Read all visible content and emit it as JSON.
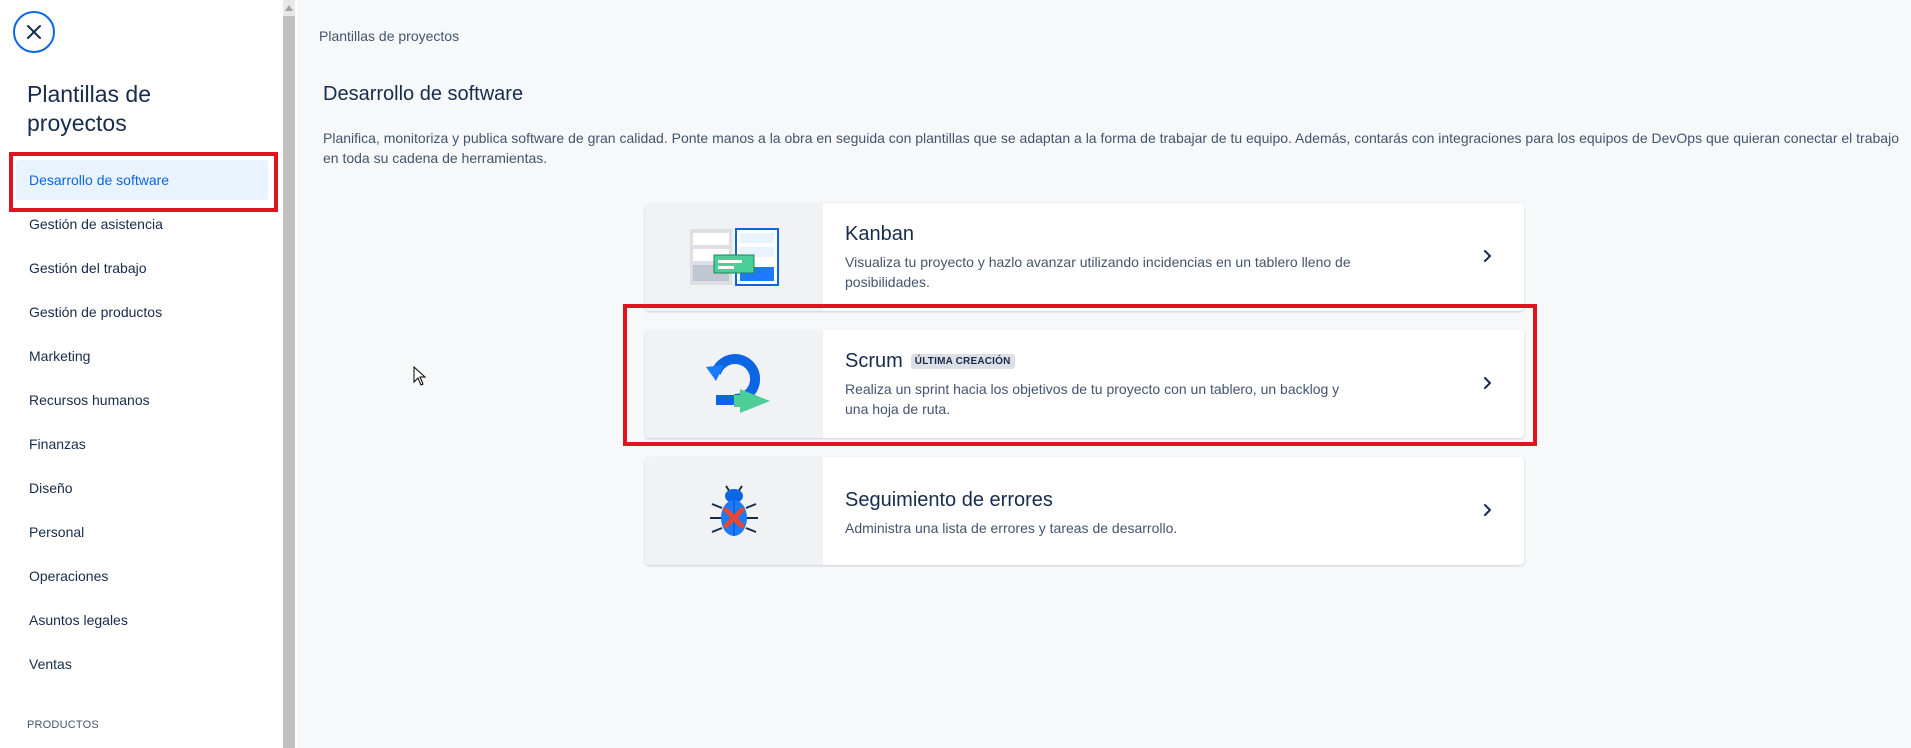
{
  "sidebar": {
    "title": "Plantillas de proyectos",
    "items": [
      {
        "label": "Desarrollo de software",
        "active": true
      },
      {
        "label": "Gestión de asistencia"
      },
      {
        "label": "Gestión del trabajo"
      },
      {
        "label": "Gestión de productos"
      },
      {
        "label": "Marketing"
      },
      {
        "label": "Recursos humanos"
      },
      {
        "label": "Finanzas"
      },
      {
        "label": "Diseño"
      },
      {
        "label": "Personal"
      },
      {
        "label": "Operaciones"
      },
      {
        "label": "Asuntos legales"
      },
      {
        "label": "Ventas"
      }
    ],
    "products_label": "PRODUCTOS"
  },
  "main": {
    "breadcrumb": "Plantillas de proyectos",
    "title": "Desarrollo de software",
    "description": "Planifica, monitoriza y publica software de gran calidad. Ponte manos a la obra en seguida con plantillas que se adaptan a la forma de trabajar de tu equipo. Además, contarás con integraciones para los equipos de DevOps que quieran conectar el trabajo en toda su cadena de herramientas.",
    "cards": [
      {
        "title": "Kanban",
        "badge": "",
        "description": "Visualiza tu proyecto y hazlo avanzar utilizando incidencias en un tablero lleno de posibilidades.",
        "icon": "kanban-board-icon"
      },
      {
        "title": "Scrum",
        "badge": "ÚLTIMA CREACIÓN",
        "description": "Realiza un sprint hacia los objetivos de tu proyecto con un tablero, un backlog y una hoja de ruta.",
        "icon": "sprint-cycle-icon"
      },
      {
        "title": "Seguimiento de errores",
        "badge": "",
        "description": "Administra una lista de errores y tareas de desarrollo.",
        "icon": "bug-icon"
      }
    ]
  },
  "colors": {
    "accent": "#0c66e4",
    "highlight": "#e0141e",
    "active_bg": "#e9f2ff"
  }
}
